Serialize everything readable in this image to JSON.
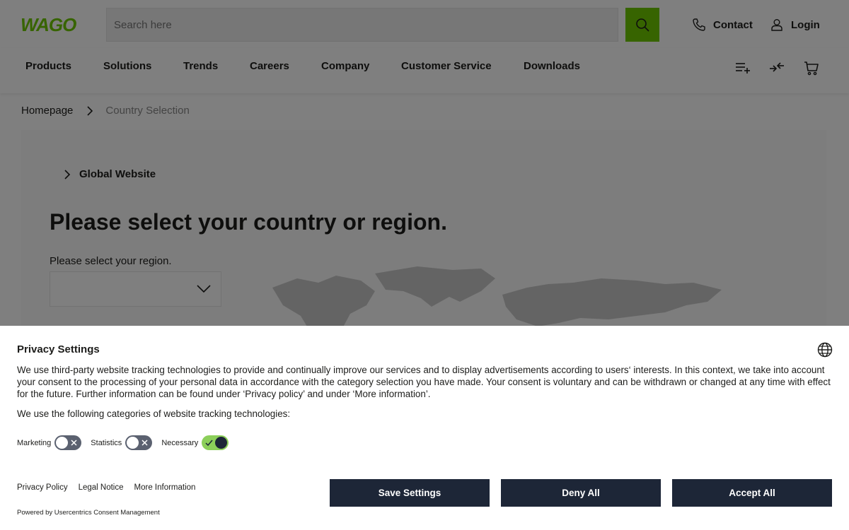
{
  "header": {
    "logo_text": "WAGO",
    "search": {
      "placeholder": "Search here"
    },
    "contact_label": "Contact",
    "login_label": "Login"
  },
  "nav": {
    "items": [
      "Products",
      "Solutions",
      "Trends",
      "Careers",
      "Company",
      "Customer Service",
      "Downloads"
    ],
    "tools": [
      "add-to-list-icon",
      "compare-icon",
      "cart-icon"
    ]
  },
  "breadcrumb": {
    "home": "Homepage",
    "current": "Country Selection"
  },
  "main": {
    "global_link": "Global Website",
    "title": "Please select your country or region.",
    "region_label": "Please select your region.",
    "region_value": ""
  },
  "consent": {
    "title": "Privacy Settings",
    "body": "We use third-party website tracking technologies to provide and continually improve our services and to display advertisements according to users‘ interests. In this context, we take into account your consent to the processing of your personal data in accordance with the category selection you have made. Your consent is voluntary and can be withdrawn or changed at any time with effect for the future. Further information can be found under ‘Privacy policy’ and under ‘More information’.",
    "categories_intro": "We use the following categories of website tracking technologies:",
    "toggles": [
      {
        "label": "Marketing",
        "state": "off"
      },
      {
        "label": "Statistics",
        "state": "off"
      },
      {
        "label": "Necessary",
        "state": "on"
      }
    ],
    "links": {
      "privacy": "Privacy Policy",
      "legal": "Legal Notice",
      "more": "More Information"
    },
    "buttons": {
      "save": "Save Settings",
      "deny": "Deny All",
      "accept": "Accept All"
    },
    "powered_by": "Powered by Usercentrics Consent Management"
  },
  "colors": {
    "brand_green": "#6ec800",
    "button_dark": "#1d2637",
    "toggle_on": "#8ccf5a",
    "toggle_off": "#5b6170"
  }
}
